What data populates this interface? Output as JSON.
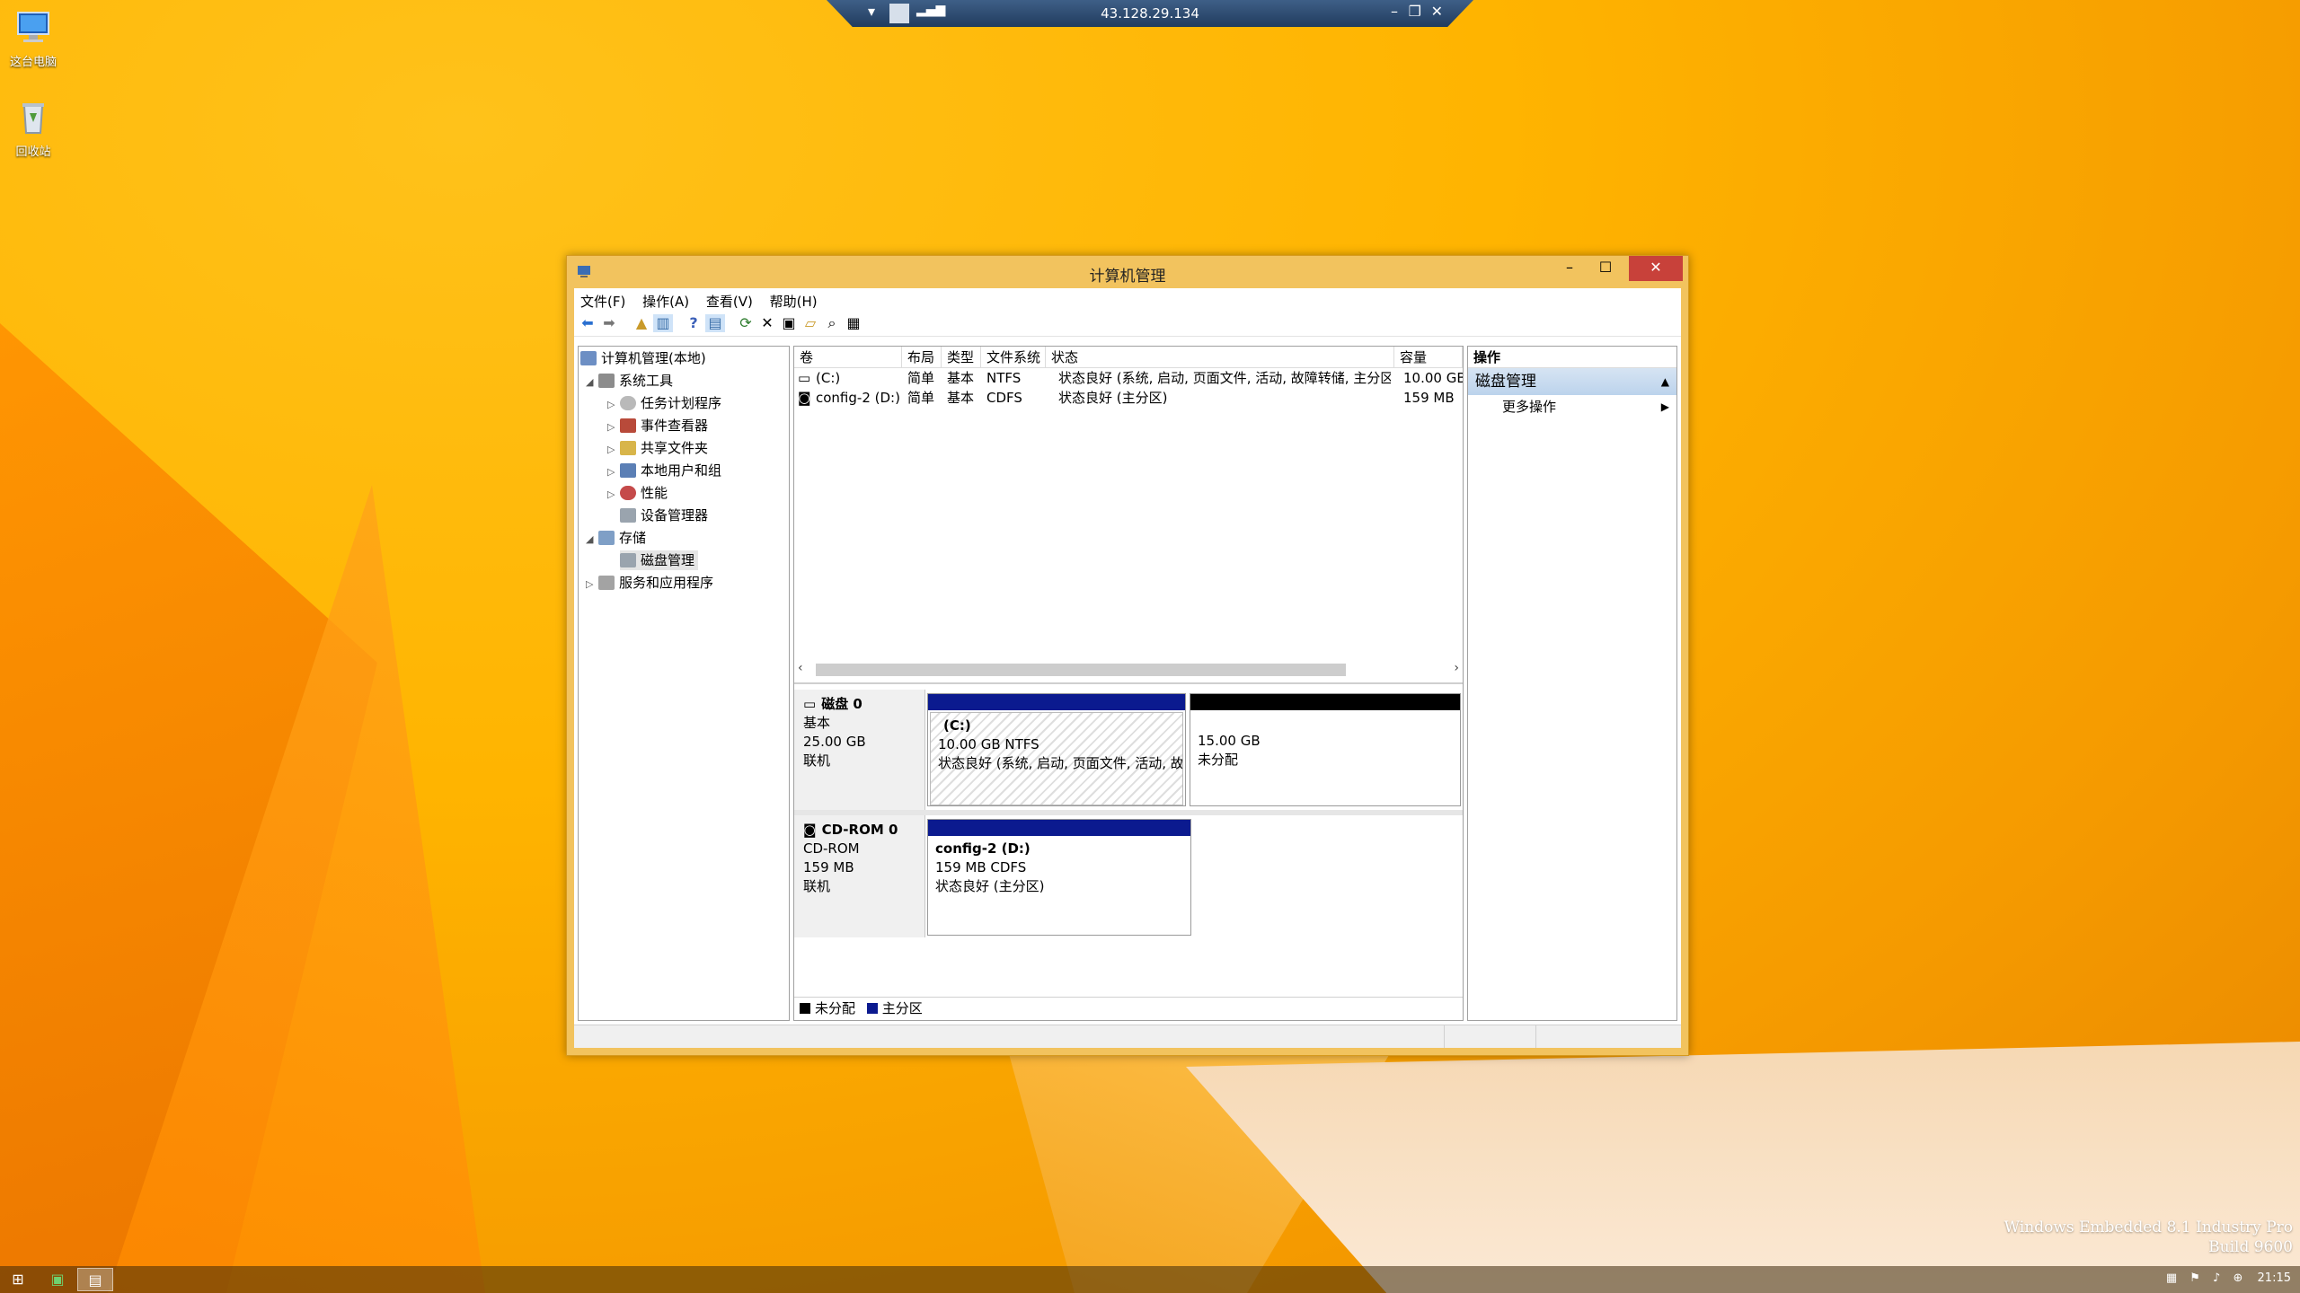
{
  "desktop": {
    "icons": [
      {
        "label": "这台电脑",
        "icon": "computer-icon"
      },
      {
        "label": "回收站",
        "icon": "recycle-bin-icon"
      }
    ],
    "watermark_line1": "Windows Embedded 8.1 Industry Pro",
    "watermark_line2": "Build 9600"
  },
  "rdp": {
    "title": "43.128.29.134"
  },
  "window": {
    "title": "计算机管理",
    "menu": [
      "文件(F)",
      "操作(A)",
      "查看(V)",
      "帮助(H)"
    ],
    "tree": {
      "root": "计算机管理(本地)",
      "system_tools": "系统工具",
      "task_scheduler": "任务计划程序",
      "event_viewer": "事件查看器",
      "shared_folders": "共享文件夹",
      "local_users": "本地用户和组",
      "performance": "性能",
      "device_manager": "设备管理器",
      "storage": "存储",
      "disk_management": "磁盘管理",
      "services_apps": "服务和应用程序"
    },
    "volume_table": {
      "columns": [
        "卷",
        "布局",
        "类型",
        "文件系统",
        "状态",
        "容量"
      ],
      "rows": [
        [
          "(C:)",
          "简单",
          "基本",
          "NTFS",
          "状态良好 (系统, 启动, 页面文件, 活动, 故障转储, 主分区)",
          "10.00 GB"
        ],
        [
          "config-2 (D:)",
          "简单",
          "基本",
          "CDFS",
          "状态良好 (主分区)",
          "159 MB"
        ]
      ]
    },
    "disks": [
      {
        "name": "磁盘 0",
        "type": "基本",
        "size": "25.00 GB",
        "state": "联机",
        "partitions": [
          {
            "title": "(C:)",
            "size_fs": "10.00 GB NTFS",
            "status": "状态良好 (系统, 启动, 页面文件, 活动, 故"
          },
          {
            "title": "",
            "size_fs": "15.00 GB",
            "status": "未分配"
          }
        ]
      },
      {
        "name": "CD-ROM 0",
        "type": "CD-ROM",
        "size": "159 MB",
        "state": "联机",
        "partitions": [
          {
            "title": "config-2  (D:)",
            "size_fs": "159 MB CDFS",
            "status": "状态良好 (主分区)"
          }
        ]
      }
    ],
    "legend": {
      "unallocated": "未分配",
      "primary": "主分区"
    },
    "actions": {
      "header": "操作",
      "group": "磁盘管理",
      "more": "更多操作"
    }
  },
  "taskbar": {
    "clock": "21:15"
  },
  "colors": {
    "primary_partition": "#0b1a8f",
    "unallocated": "#000000",
    "close_button": "#c8413a"
  }
}
